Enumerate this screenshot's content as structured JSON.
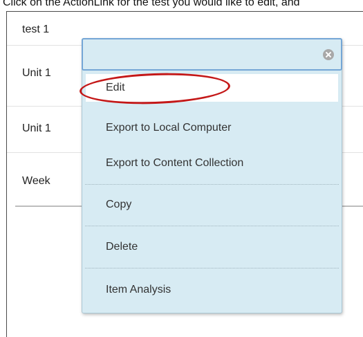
{
  "instruction": "Click on the ActionLink for the test you would like to edit, and",
  "list_items": [
    "test 1",
    "Unit 1",
    "Unit 1",
    "Week"
  ],
  "context_menu": {
    "items": [
      {
        "label": "Edit",
        "highlighted": true
      },
      {
        "label": "Export to Local Computer"
      },
      {
        "label": "Export to Content Collection"
      },
      {
        "label": "Copy"
      },
      {
        "label": "Delete"
      },
      {
        "label": "Item Analysis"
      }
    ]
  },
  "colors": {
    "menu_background": "#d7ebf3",
    "menu_header_border": "#74a6d6",
    "highlight_oval": "#c41818"
  }
}
